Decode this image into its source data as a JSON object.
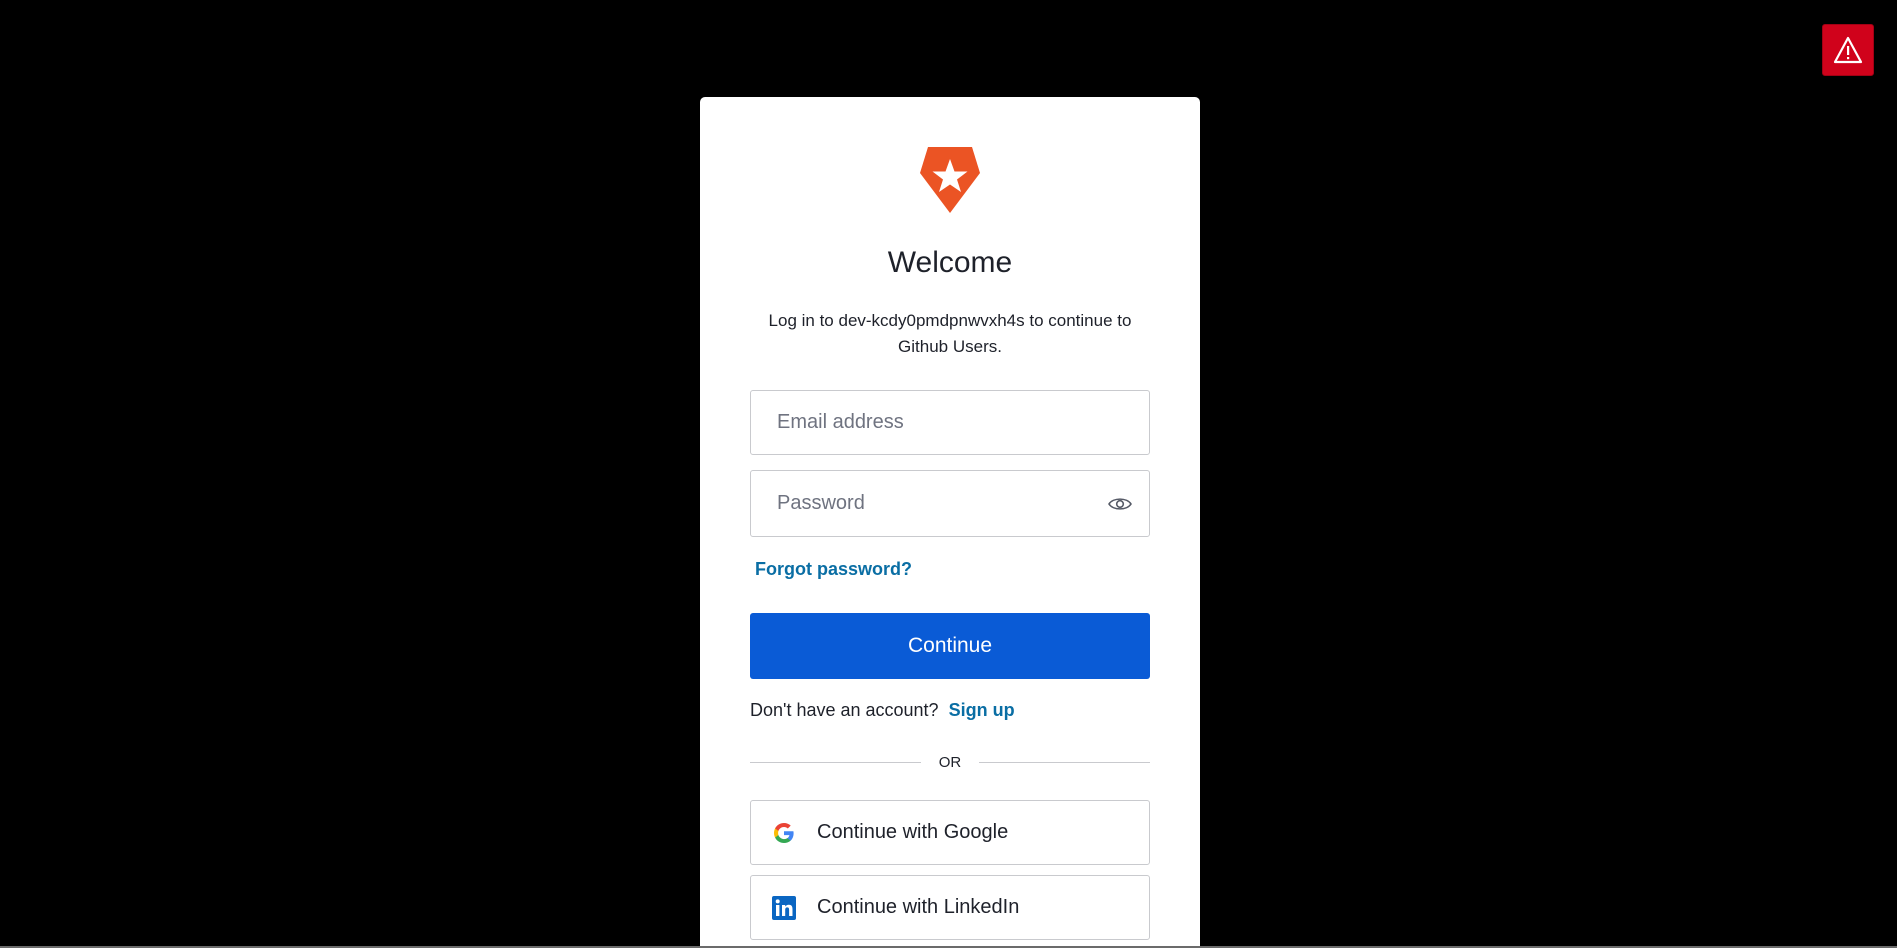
{
  "header": {
    "title": "Welcome",
    "subtitle": "Log in to dev-kcdy0pmdpnwvxh4s to continue to Github Users."
  },
  "form": {
    "email_placeholder": "Email address",
    "password_placeholder": "Password",
    "forgot_password": "Forgot password?",
    "continue_label": "Continue"
  },
  "signup": {
    "prompt": "Don't have an account?",
    "link": "Sign up"
  },
  "divider": {
    "text": "OR"
  },
  "social": {
    "google_label": "Continue with Google",
    "linkedin_label": "Continue with LinkedIn"
  },
  "colors": {
    "background": "#000000",
    "card": "#ffffff",
    "brand_logo": "#eb5424",
    "primary_button": "#0a5bd6",
    "link": "#0a6ea4",
    "warning": "#d0021b",
    "linkedin": "#0a66c2"
  },
  "icons": {
    "warning": "warning-triangle-icon",
    "logo": "auth0-shield-star-logo",
    "password_toggle": "eye-icon",
    "google": "google-g-icon",
    "linkedin": "linkedin-in-icon"
  }
}
